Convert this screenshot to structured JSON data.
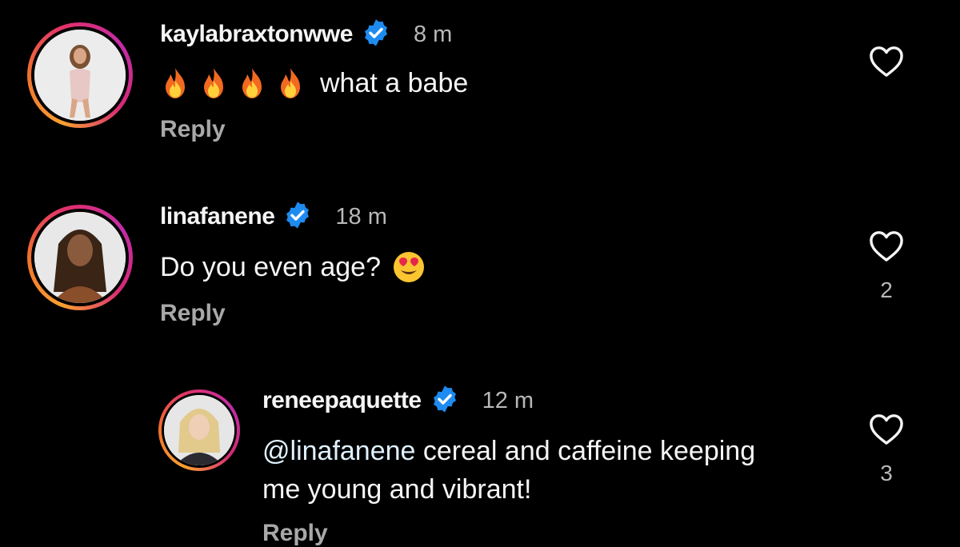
{
  "comments": [
    {
      "username": "kaylabraxtonwwe",
      "time": "8 m",
      "text": "what a babe",
      "emoji": [
        "fire",
        "fire",
        "fire",
        "fire"
      ],
      "reply_label": "Reply",
      "likes": ""
    },
    {
      "username": "linafanene",
      "time": "18 m",
      "text": "Do you even age?",
      "emoji": [
        "heart-eyes"
      ],
      "reply_label": "Reply",
      "likes": "2"
    },
    {
      "username": "reneepaquette",
      "time": "12 m",
      "mention": "@linafanene",
      "text_line1": " cereal and caffeine keeping",
      "text_line2": "me young and vibrant!",
      "reply_label": "Reply",
      "likes": "3"
    }
  ],
  "colors": {
    "background": "#000000",
    "verified_badge": "#1e8bf0",
    "secondary_text": "#a8a8a8"
  },
  "icons": {
    "verified": "verified-badge-icon",
    "like": "heart-outline-icon"
  }
}
